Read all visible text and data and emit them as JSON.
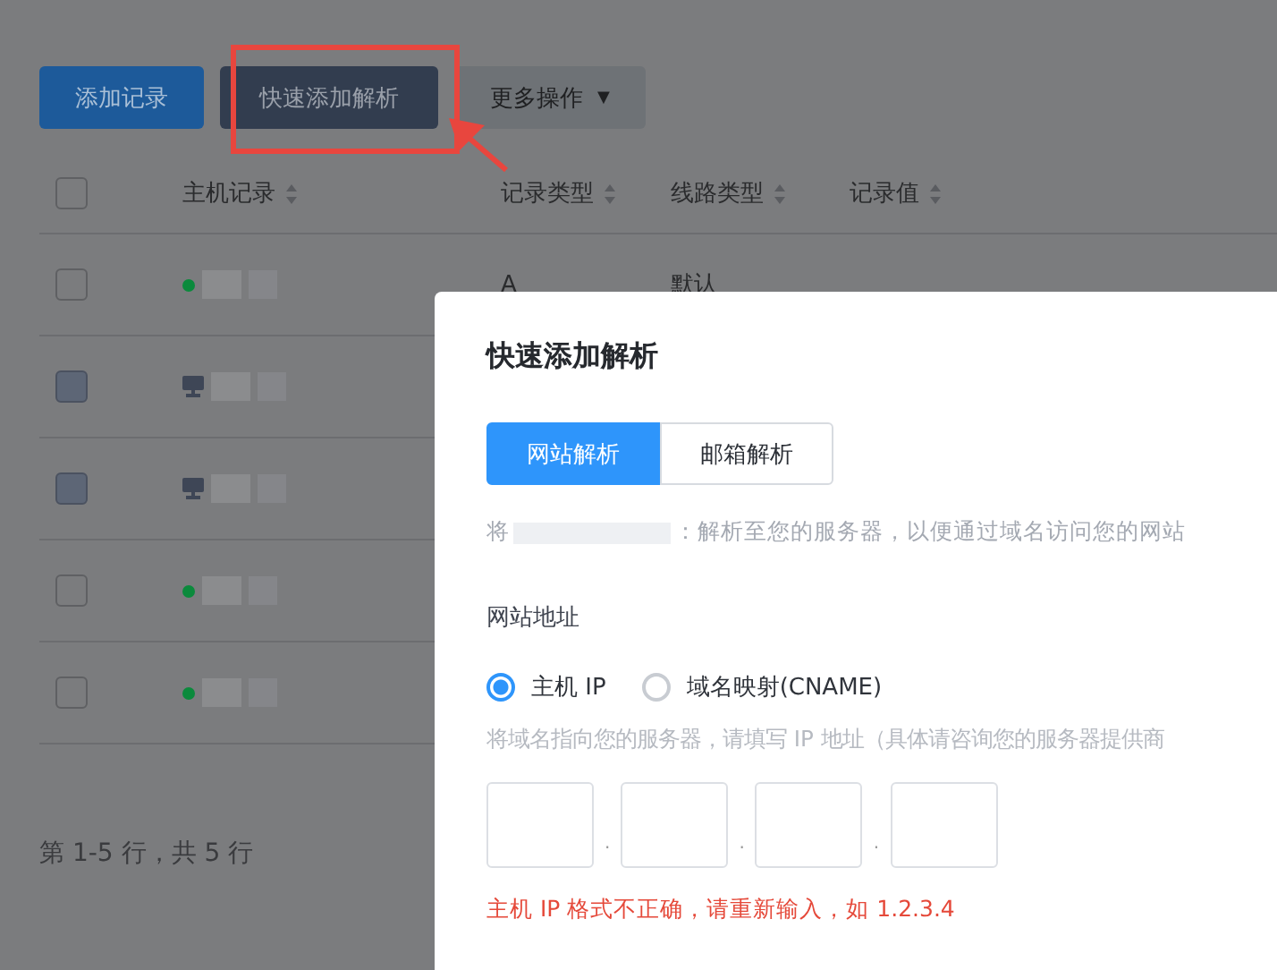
{
  "toolbar": {
    "buttons": [
      {
        "label": "添加记录",
        "kind": "primary"
      },
      {
        "label": "快速添加解析",
        "kind": "dark"
      },
      {
        "label": "更多操作",
        "kind": "menu",
        "caret": "▼"
      }
    ]
  },
  "table": {
    "columns": [
      {
        "label": "主机记录"
      },
      {
        "label": "记录类型"
      },
      {
        "label": "线路类型"
      },
      {
        "label": "记录值"
      }
    ],
    "rows": [
      {
        "kind": "online",
        "disabled": false,
        "type": "A",
        "line": "默认"
      },
      {
        "kind": "device",
        "disabled": true
      },
      {
        "kind": "device",
        "disabled": true
      },
      {
        "kind": "online",
        "disabled": false
      },
      {
        "kind": "online",
        "disabled": false
      }
    ],
    "select_all": {
      "checked": false
    }
  },
  "pagination": "第 1-5 行，共 5 行",
  "dialog": {
    "title": "快速添加解析",
    "tabs": [
      {
        "label": "网站解析",
        "selected": true
      },
      {
        "label": "邮箱解析",
        "selected": false
      }
    ],
    "description_start": "将",
    "description_end": "：解析至您的服务器，以便通过域名访问您的网站",
    "field_label": "网站地址",
    "radios": [
      {
        "label": "主机 IP",
        "selected": true
      },
      {
        "label": "域名映射(CNAME)",
        "selected": false
      }
    ],
    "hint": "将域名指向您的服务器，请填写 IP 地址（具体请咨询您的服务器提供商",
    "separator": ".",
    "error": "主机 IP 格式不正确，请重新输入，如 1.2.3.4"
  }
}
